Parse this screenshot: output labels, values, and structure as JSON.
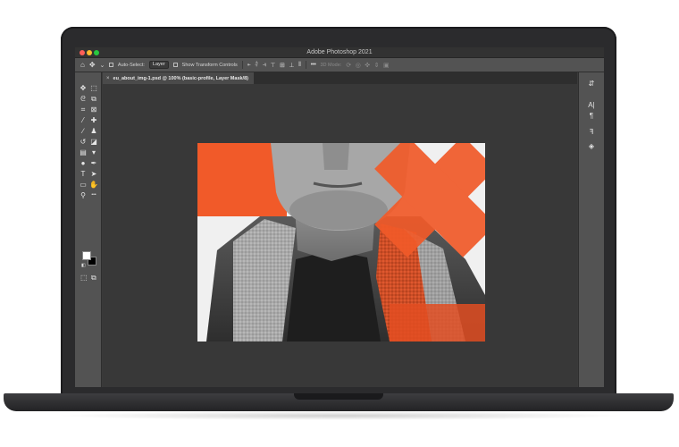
{
  "app": {
    "title": "Adobe Photoshop 2021"
  },
  "options_bar": {
    "home_icon": "home-icon",
    "move_icon": "move-tool-icon",
    "auto_select_label": "Auto-Select:",
    "auto_select_value": "Layer",
    "transform_label": "Show Transform Controls",
    "more_label": "•••",
    "mode_3d_label": "3D Mode:"
  },
  "document": {
    "tab_label": "eu_about_img-1.psd @ 100% (basic-profile, Layer Mask/8)",
    "tab_close": "×"
  },
  "toolbar": {
    "tools": [
      {
        "name": "move-tool-icon",
        "glyph": "✥"
      },
      {
        "name": "marquee-tool-icon",
        "glyph": "⬚"
      },
      {
        "name": "lasso-tool-icon",
        "glyph": "ᘓ"
      },
      {
        "name": "object-select-tool-icon",
        "glyph": "⧉"
      },
      {
        "name": "crop-tool-icon",
        "glyph": "⌗"
      },
      {
        "name": "frame-tool-icon",
        "glyph": "⊠"
      },
      {
        "name": "eyedropper-tool-icon",
        "glyph": "⁄"
      },
      {
        "name": "healing-brush-tool-icon",
        "glyph": "✚"
      },
      {
        "name": "brush-tool-icon",
        "glyph": "∕"
      },
      {
        "name": "clone-stamp-tool-icon",
        "glyph": "♟"
      },
      {
        "name": "history-brush-tool-icon",
        "glyph": "↺"
      },
      {
        "name": "eraser-tool-icon",
        "glyph": "◪"
      },
      {
        "name": "gradient-tool-icon",
        "glyph": "▤"
      },
      {
        "name": "blur-tool-icon",
        "glyph": "▾"
      },
      {
        "name": "dodge-tool-icon",
        "glyph": "●"
      },
      {
        "name": "pen-tool-icon",
        "glyph": "✒"
      },
      {
        "name": "type-tool-icon",
        "glyph": "T"
      },
      {
        "name": "path-select-tool-icon",
        "glyph": "➤"
      },
      {
        "name": "rectangle-tool-icon",
        "glyph": "▭"
      },
      {
        "name": "hand-tool-icon",
        "glyph": "✋"
      },
      {
        "name": "zoom-tool-icon",
        "glyph": "⚲"
      },
      {
        "name": "edit-toolbar-icon",
        "glyph": "•••"
      }
    ],
    "foreground_color": "#ffffff",
    "background_color": "#000000"
  },
  "right_panel": {
    "icons": [
      {
        "name": "learn-panel-icon",
        "glyph": "⇵"
      },
      {
        "name": "character-panel-icon",
        "glyph": "A|"
      },
      {
        "name": "paragraph-panel-icon",
        "glyph": "¶"
      },
      {
        "name": "glyphs-panel-icon",
        "glyph": "ꟻ"
      },
      {
        "name": "layers-panel-icon",
        "glyph": "◈"
      }
    ]
  },
  "colors": {
    "accent_orange": "#f15a29",
    "ui_dark": "#535353",
    "canvas_bg": "#383838"
  }
}
